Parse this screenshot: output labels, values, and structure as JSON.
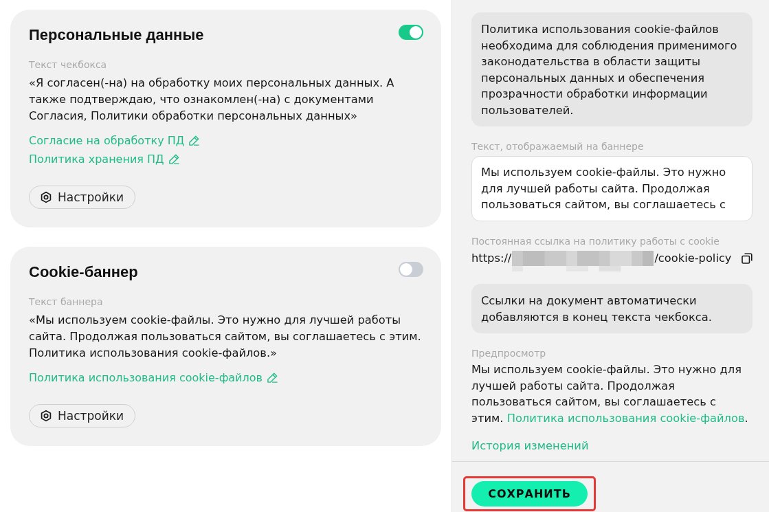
{
  "sections": [
    {
      "title": "Персональные данные",
      "enabled": true,
      "text_label": "Текст чекбокса",
      "text": "«Я согласен(-на) на обработку моих персональных данных. А также подтверждаю, что ознакомлен(-на) с документами Согласия, Политики обработки персональных данных»",
      "links": [
        "Согласие на обработку ПД",
        "Политика хранения ПД"
      ],
      "settings_button": "Настройки"
    },
    {
      "title": "Cookie-баннер",
      "enabled": false,
      "text_label": "Текст баннера",
      "text": "«Мы используем cookie-файлы. Это нужно для лучшей работы сайта. Продолжая пользоваться сайтом, вы соглашаетесь с этим. Политика использования cookie-файлов.»",
      "links": [
        "Политика использования cookie-файлов"
      ],
      "settings_button": "Настройки"
    }
  ],
  "cookie_panel": {
    "notice": "Политика использования cookie-файлов необходима для соблюдения применимого законодательства в области защиты персональных данных и обеспечения прозрачности обработки информации пользователей.",
    "banner_text": {
      "label": "Текст, отображаемый на баннере",
      "value": "Мы используем cookie-файлы. Это нужно для лучшей работы сайта. Продолжая пользоваться сайтом, вы соглашаетесь с"
    },
    "permalink": {
      "label": "Постоянная ссылка на политику работы с cookie",
      "prefix": "https://",
      "suffix": "/cookie-policy"
    },
    "hint": "Ссылки на документ автоматически добавляются в конец текста чекбокса.",
    "preview": {
      "label": "Предпросмотр",
      "text": "Мы используем cookie-файлы. Это нужно для лучшей работы сайта. Продолжая пользоваться сайтом, вы соглашаетесь с этим.",
      "link": "Политика использования cookie-файлов",
      "after": "."
    },
    "history_link": "История изменений"
  },
  "save_button": {
    "label": "СОХРАНИТЬ",
    "highlighted": true
  }
}
